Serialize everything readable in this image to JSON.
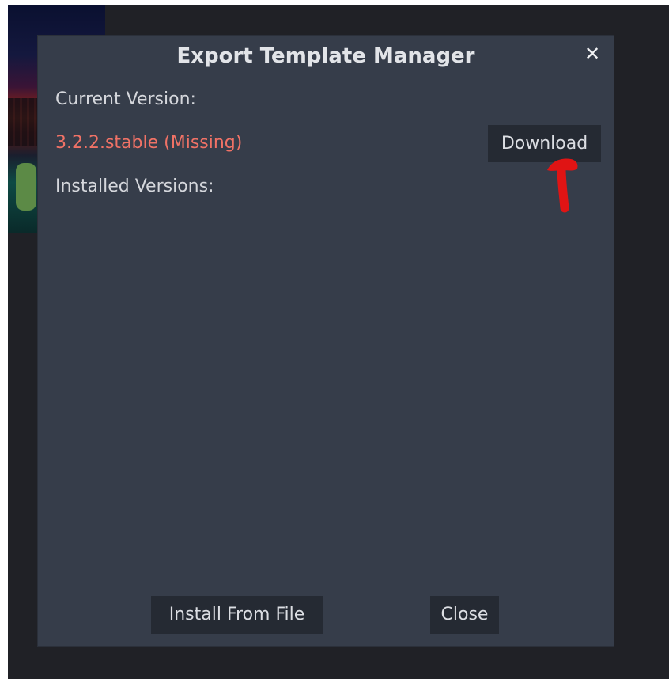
{
  "dialog": {
    "title": "Export Template Manager",
    "current_version_label": "Current Version:",
    "current_version_value": "3.2.2.stable (Missing)",
    "download_label": "Download",
    "installed_versions_label": "Installed Versions:",
    "install_from_file_label": "Install From File",
    "close_label": "Close"
  },
  "annotation": {
    "arrow_color": "#e01414"
  },
  "colors": {
    "dialog_bg": "#363d4a",
    "button_bg": "#252a33",
    "missing_text": "#f07266"
  }
}
